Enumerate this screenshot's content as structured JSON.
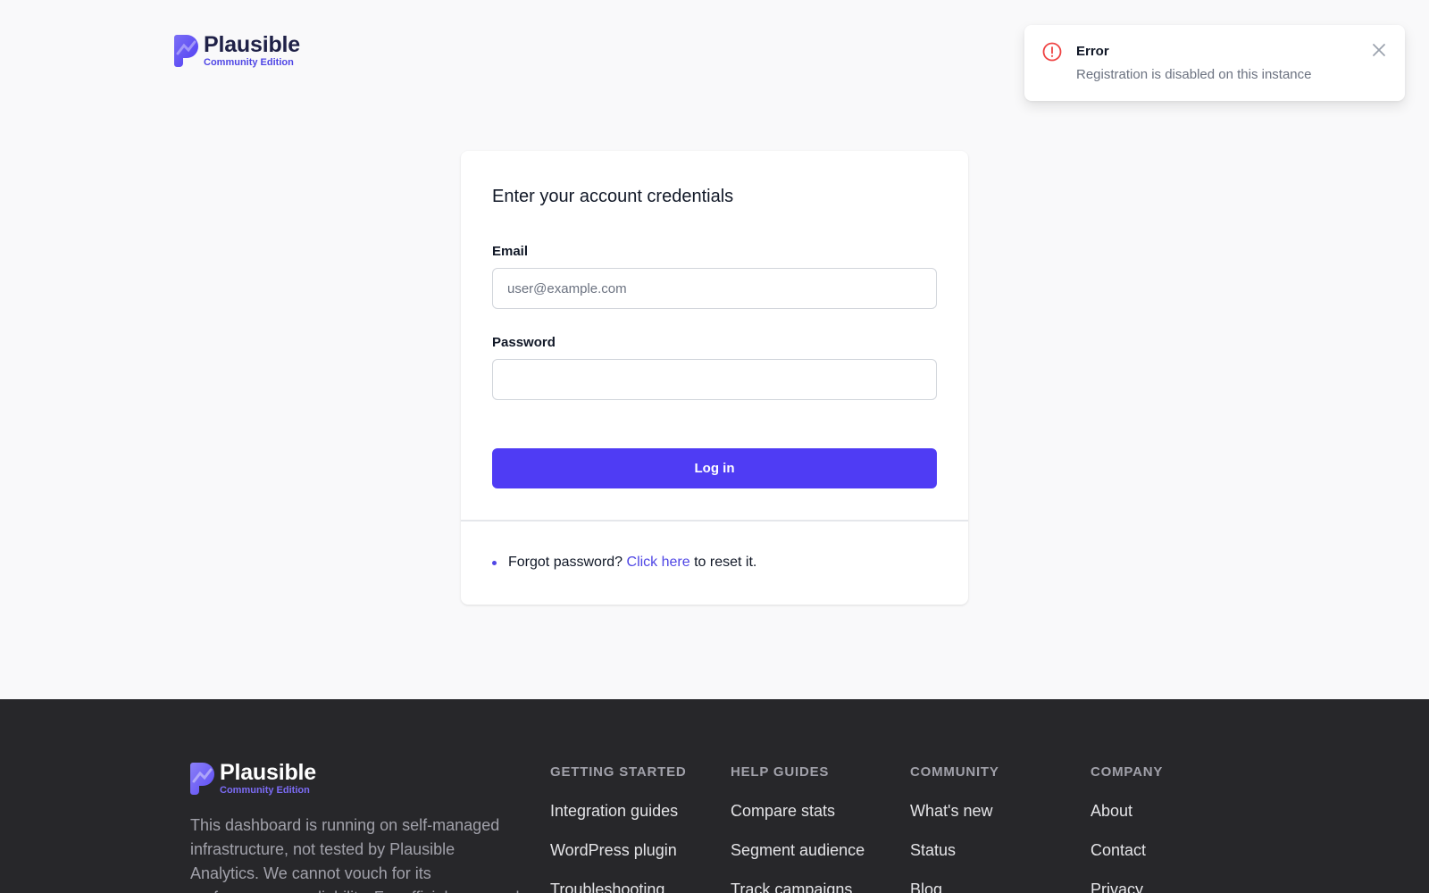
{
  "brand": {
    "name": "Plausible",
    "edition": "Community Edition",
    "accent_color": "#4f46e5"
  },
  "toast": {
    "icon": "exclamation-circle-icon",
    "title": "Error",
    "message": "Registration is disabled on this instance",
    "close_icon": "close-icon",
    "icon_color": "#ef4444"
  },
  "login": {
    "title": "Enter your account credentials",
    "email_label": "Email",
    "email_placeholder": "user@example.com",
    "email_value": "",
    "password_label": "Password",
    "password_value": "",
    "submit_label": "Log in",
    "button_color": "#4f3cf4",
    "forgot_prefix": "Forgot password? ",
    "forgot_link": "Click here",
    "forgot_suffix": " to reset it."
  },
  "footer": {
    "description": "This dashboard is running on self-managed infrastructure, not tested by Plausible Analytics. We cannot vouch for its performance or reliability. For official managed",
    "columns": [
      {
        "heading": "GETTING STARTED",
        "links": [
          "Integration guides",
          "WordPress plugin",
          "Troubleshooting"
        ]
      },
      {
        "heading": "HELP GUIDES",
        "links": [
          "Compare stats",
          "Segment audience",
          "Track campaigns"
        ]
      },
      {
        "heading": "COMMUNITY",
        "links": [
          "What's new",
          "Status",
          "Blog"
        ]
      },
      {
        "heading": "COMPANY",
        "links": [
          "About",
          "Contact",
          "Privacy"
        ]
      }
    ],
    "background_color": "#27272a"
  }
}
